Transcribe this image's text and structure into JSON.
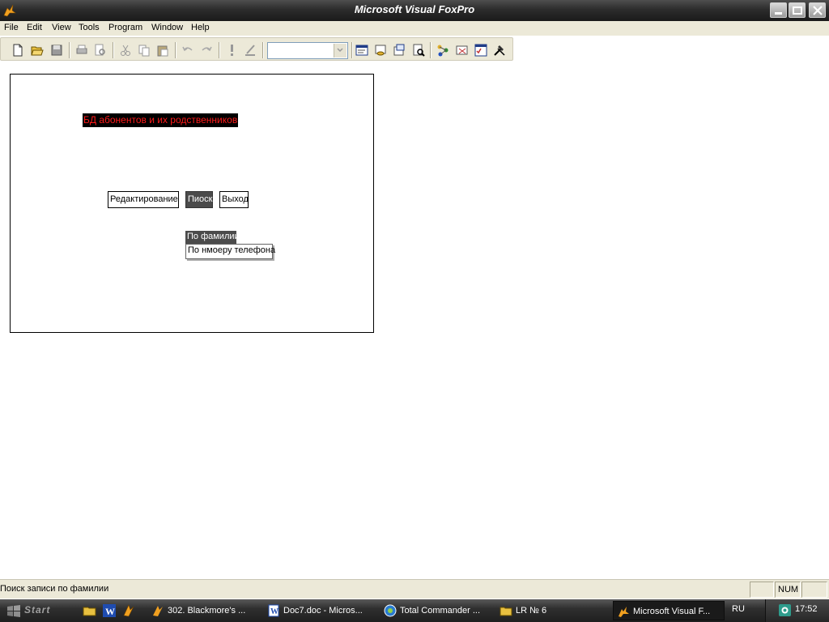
{
  "window": {
    "title": "Microsoft Visual FoxPro"
  },
  "menu": {
    "items": [
      "File",
      "Edit",
      "View",
      "Tools",
      "Program",
      "Window",
      "Help"
    ]
  },
  "toolbar": {
    "combo_value": ""
  },
  "form": {
    "title": "БД абонентов и их родственников",
    "buttons": {
      "edit": "Редактирование",
      "search": "Пиоск",
      "exit": "Выход"
    },
    "search_menu": {
      "by_surname": "По фамилии",
      "by_phone": "По нмоеру телефона"
    }
  },
  "statusbar": {
    "message": "Поиск записи по фамилии",
    "num": "NUM"
  },
  "taskbar": {
    "start_label": "Start",
    "tasks": [
      {
        "label": "302. Blackmore's ...",
        "icon": "winamp-icon"
      },
      {
        "label": "Doc7.doc - Micros...",
        "icon": "word-doc-icon"
      },
      {
        "label": "Total Commander ...",
        "icon": "total-commander-icon"
      },
      {
        "label": "LR № 6",
        "icon": "folder-icon"
      },
      {
        "label": "Microsoft Visual F...",
        "icon": "foxpro-icon"
      }
    ],
    "language": "RU",
    "clock": "17:52"
  },
  "colors": {
    "form_title_text": "#ff1a1a",
    "form_title_bg": "#000000",
    "active_button_bg": "#4b4b4b",
    "chrome": "#ece9d8"
  }
}
